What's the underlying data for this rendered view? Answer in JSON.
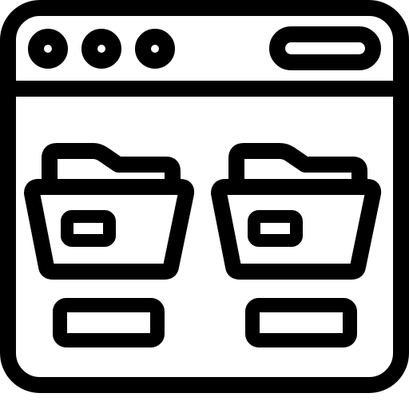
{
  "icon": {
    "name": "browser-window-folders-icon",
    "color": "#000000",
    "background": "#ffffff"
  },
  "window": {
    "title_bar_buttons": [
      "circle-button-icon",
      "circle-button-icon",
      "circle-button-icon"
    ],
    "address_bar_icon": "pill-bar-icon"
  },
  "folders": [
    {
      "name": "folder-icon"
    },
    {
      "name": "folder-icon"
    }
  ]
}
